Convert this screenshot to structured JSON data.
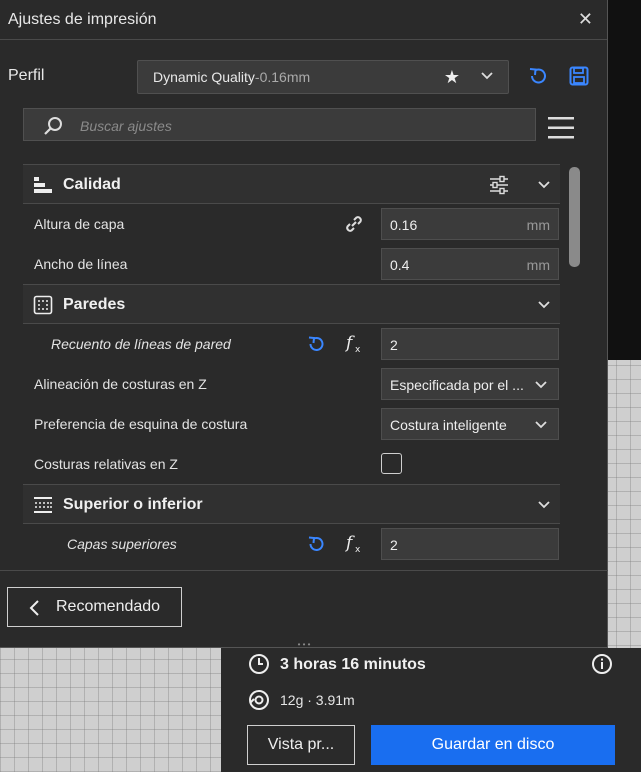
{
  "window": {
    "title": "Ajustes de impresión"
  },
  "profile": {
    "label": "Perfil",
    "name": "Dynamic Quality",
    "separator": " - ",
    "variant": "0.16mm"
  },
  "search": {
    "placeholder": "Buscar ajustes",
    "value": ""
  },
  "categories": {
    "quality": {
      "label": "Calidad"
    },
    "walls": {
      "label": "Paredes"
    },
    "topbottom": {
      "label": "Superior o inferior"
    }
  },
  "settings": {
    "layer_height": {
      "label": "Altura de capa",
      "value": "0.16",
      "unit": "mm"
    },
    "line_width": {
      "label": "Ancho de línea",
      "value": "0.4",
      "unit": "mm"
    },
    "wall_line_count": {
      "label": "Recuento de líneas de pared",
      "value": "2"
    },
    "z_seam_alignment": {
      "label": "Alineación de costuras en Z",
      "value": "Especificada por el ..."
    },
    "seam_corner_pref": {
      "label": "Preferencia de esquina de costura",
      "value": "Costura inteligente"
    },
    "z_seam_relative": {
      "label": "Costuras relativas en Z",
      "checked": false
    },
    "top_layers": {
      "label": "Capas superiores",
      "value": "2"
    }
  },
  "footer": {
    "recommended_label": "Recomendado"
  },
  "summary": {
    "print_time": "3 horas 16 minutos",
    "material": "12g · 3.91m",
    "preview_label": "Vista pr...",
    "save_label": "Guardar en disco"
  },
  "colors": {
    "accent": "#196ef0",
    "panel": "#2a2a2a",
    "icon_blue": "#3a86ff"
  }
}
